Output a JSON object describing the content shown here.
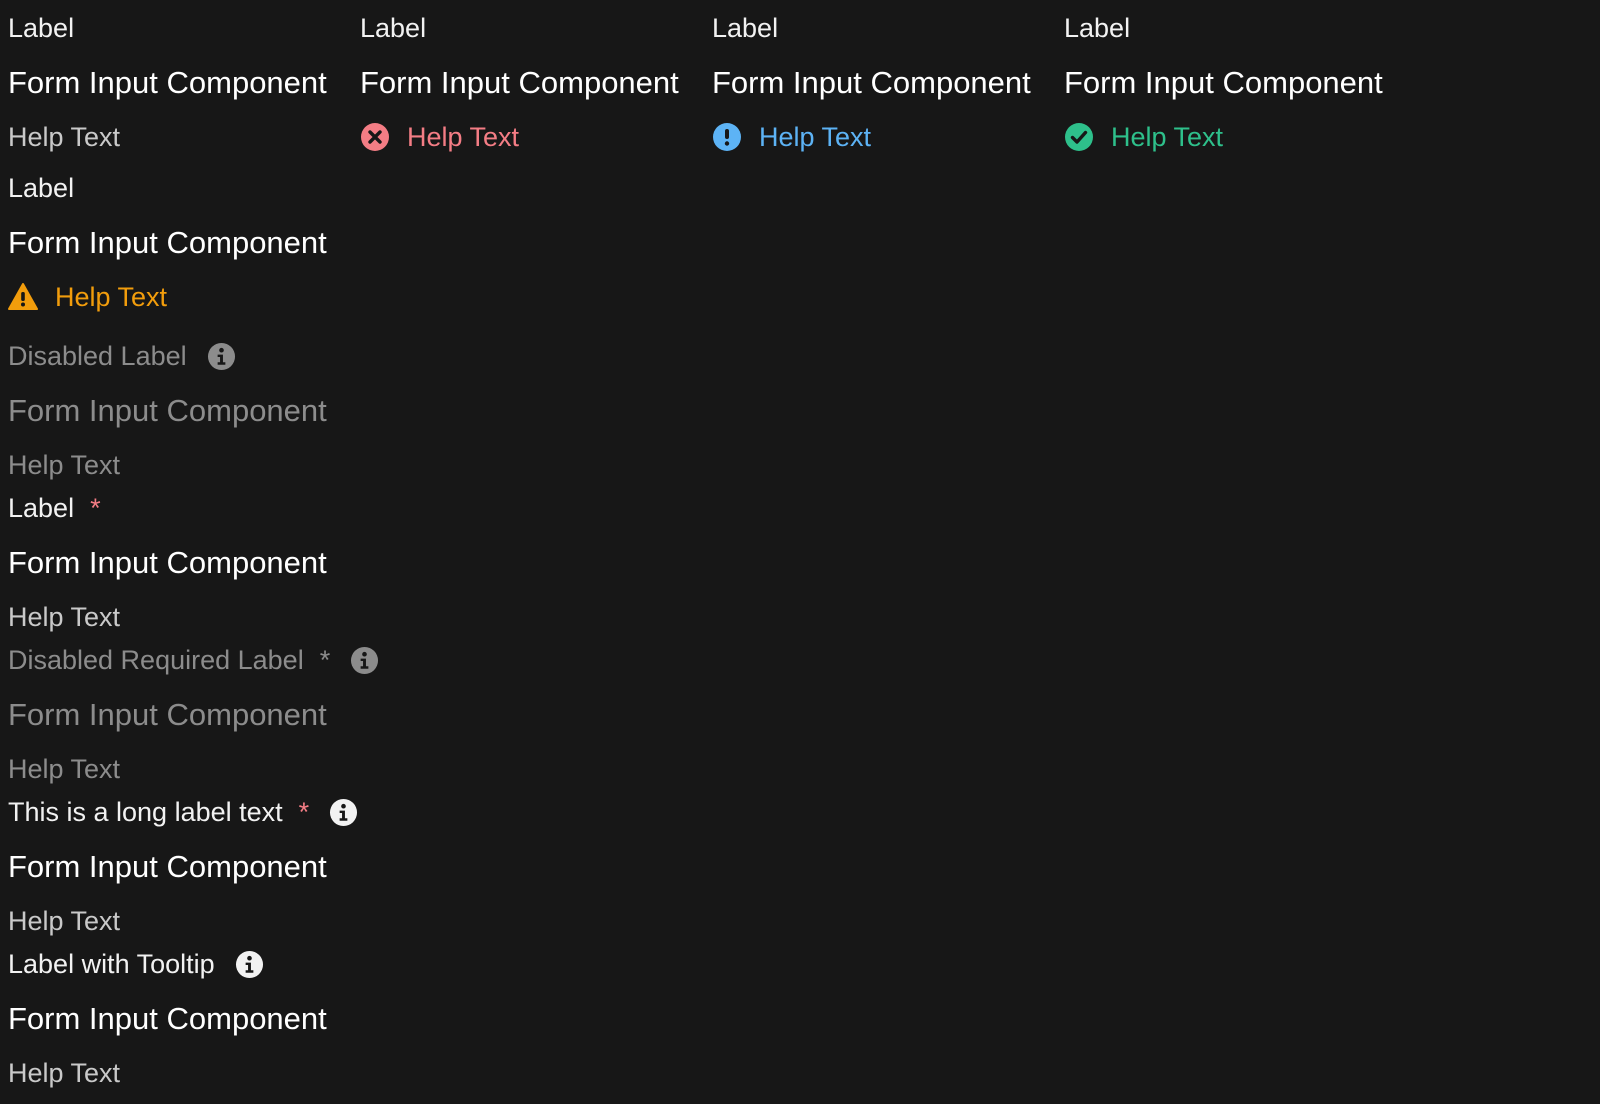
{
  "colors": {
    "background": "#171717",
    "label": "#f2f2f2",
    "help": "#c9c9c9",
    "disabled": "#8c8c8c",
    "error": "#f47d85",
    "info": "#5db3f5",
    "success": "#2ec08b",
    "warning": "#f29d0c",
    "required": "#f47d85"
  },
  "fields": {
    "default": {
      "label": "Label",
      "input": "Form Input Component",
      "help": "Help Text"
    },
    "error": {
      "label": "Label",
      "input": "Form Input Component",
      "help": "Help Text",
      "icon": "error-x-icon"
    },
    "info": {
      "label": "Label",
      "input": "Form Input Component",
      "help": "Help Text",
      "icon": "info-exclamation-icon"
    },
    "success": {
      "label": "Label",
      "input": "Form Input Component",
      "help": "Help Text",
      "icon": "check-circle-icon"
    },
    "warning": {
      "label": "Label",
      "input": "Form Input Component",
      "help": "Help Text",
      "icon": "warning-triangle-icon"
    },
    "disabled": {
      "label": "Disabled Label",
      "input": "Form Input Component",
      "help": "Help Text",
      "icon": "info-icon"
    },
    "required": {
      "label": "Label",
      "asterisk": "*",
      "input": "Form Input Component",
      "help": "Help Text"
    },
    "disabled_required": {
      "label": "Disabled Required Label",
      "asterisk": "*",
      "input": "Form Input Component",
      "help": "Help Text",
      "icon": "info-icon"
    },
    "long_label": {
      "label": "This is a long label text",
      "asterisk": "*",
      "input": "Form Input Component",
      "help": "Help Text",
      "icon": "info-icon"
    },
    "tooltip": {
      "label": "Label with Tooltip",
      "input": "Form Input Component",
      "help": "Help Text",
      "icon": "info-icon"
    }
  }
}
